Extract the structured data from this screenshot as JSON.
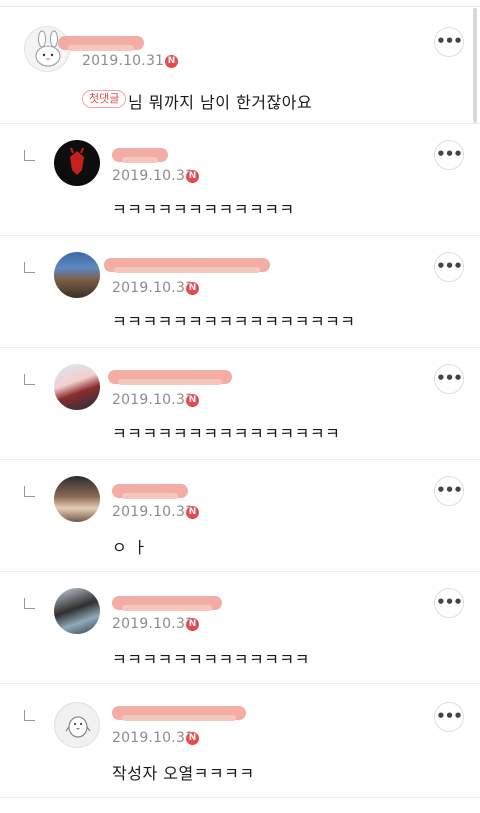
{
  "comments": [
    {
      "date": "2019.10.31",
      "new_badge": "N",
      "text": "님 뭐까지 남이 한거잖아요",
      "first_badge": "첫댓글",
      "more": "•••"
    },
    {
      "date": "2019.10.31",
      "new_badge": "N",
      "text": "ㅋㅋㅋㅋㅋㅋㅋㅋㅋㅋㅋㅋ",
      "more": "•••"
    },
    {
      "date": "2019.10.31",
      "new_badge": "N",
      "text": "ㅋㅋㅋㅋㅋㅋㅋㅋㅋㅋㅋㅋㅋㅋㅋㅋ",
      "more": "•••"
    },
    {
      "date": "2019.10.31",
      "new_badge": "N",
      "text": "ㅋㅋㅋㅋㅋㅋㅋㅋㅋㅋㅋㅋㅋㅋㅋ",
      "more": "•••"
    },
    {
      "date": "2019.10.31",
      "new_badge": "N",
      "text": "ㅇ ㅏ",
      "more": "•••"
    },
    {
      "date": "2019.10.31",
      "new_badge": "N",
      "text": "ㅋㅋㅋㅋㅋㅋㅋㅋㅋㅋㅋㅋㅋ",
      "more": "•••"
    },
    {
      "date": "2019.10.31",
      "new_badge": "N",
      "text": "작성자 오열ㅋㅋㅋㅋ",
      "more": "•••"
    }
  ],
  "colors": {
    "accent_red": "#e84a4a",
    "redaction": "#f2a59b"
  }
}
